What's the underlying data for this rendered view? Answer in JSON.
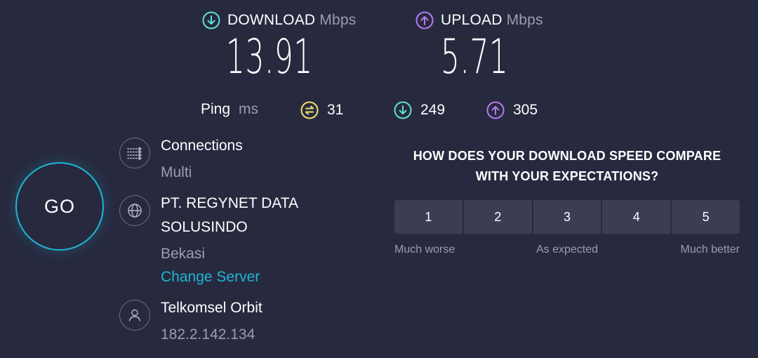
{
  "download": {
    "label": "DOWNLOAD",
    "unit": "Mbps",
    "value": "13.91"
  },
  "upload": {
    "label": "UPLOAD",
    "unit": "Mbps",
    "value": "5.71"
  },
  "ping": {
    "label": "Ping",
    "unit": "ms",
    "idle": "31",
    "download": "249",
    "upload": "305"
  },
  "go_label": "GO",
  "connections": {
    "title": "Connections",
    "value": "Multi"
  },
  "server": {
    "name_line1": "PT. REGYNET DATA",
    "name_line2": "SOLUSINDO",
    "location": "Bekasi",
    "change_link": "Change Server"
  },
  "provider": {
    "name": "Telkomsel Orbit",
    "ip": "182.2.142.134"
  },
  "survey": {
    "question_line1": "HOW DOES YOUR DOWNLOAD SPEED COMPARE",
    "question_line2": "WITH YOUR EXPECTATIONS?",
    "options": [
      "1",
      "2",
      "3",
      "4",
      "5"
    ],
    "scale_low": "Much worse",
    "scale_mid": "As expected",
    "scale_high": "Much better"
  },
  "colors": {
    "background": "#272a3f",
    "download_accent": "#5fe0d6",
    "upload_accent": "#b57bf0",
    "ping_accent": "#f3de6e",
    "link": "#1fb5d4"
  },
  "icons": {
    "download": "download-arrow-icon",
    "upload": "upload-arrow-icon",
    "ping": "jitter-icon",
    "connections": "connections-icon",
    "server": "globe-icon",
    "provider": "user-icon"
  }
}
